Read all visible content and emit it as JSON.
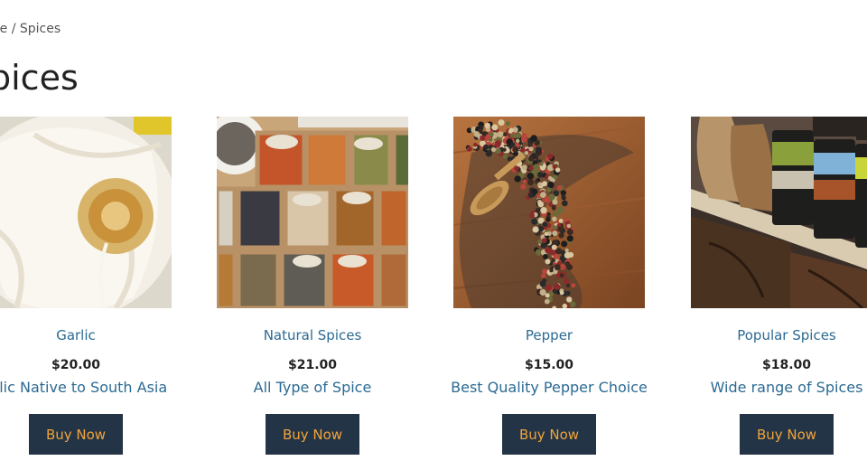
{
  "breadcrumb": "me / Spices",
  "page_title": "pices",
  "products": [
    {
      "name": "Garlic",
      "price": "$20.00",
      "description": "arlic Native to South Asia",
      "button": "Buy Now"
    },
    {
      "name": "Natural Spices",
      "price": "$21.00",
      "description": "All Type of Spice",
      "button": "Buy Now"
    },
    {
      "name": "Pepper",
      "price": "$15.00",
      "description": "Best Quality Pepper Choice",
      "button": "Buy Now"
    },
    {
      "name": "Popular Spices",
      "price": "$18.00",
      "description": "Wide range of Spices",
      "button": "Buy Now"
    }
  ],
  "colors": {
    "link": "#2b6a93",
    "button_bg": "#243447",
    "button_text": "#f0a43a"
  }
}
